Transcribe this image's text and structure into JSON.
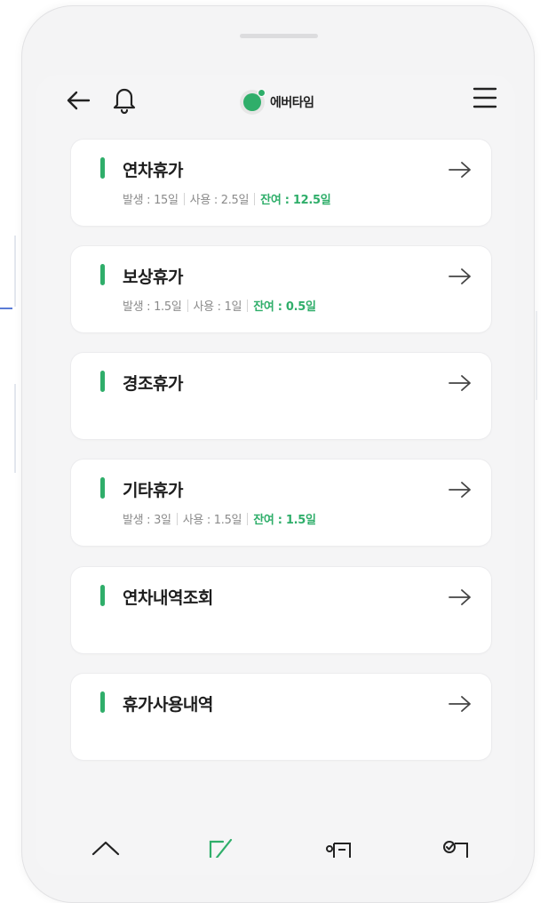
{
  "header": {
    "brand": "에버타임",
    "icons": [
      "arrow-left-icon",
      "bell-icon",
      "hamburger-menu-icon"
    ]
  },
  "cards": [
    {
      "title": "연차휴가",
      "issued": "발생 : 15일",
      "used": "사용 : 2.5일",
      "remaining": "잔여 : 12.5일"
    },
    {
      "title": "보상휴가",
      "issued": "발생 : 1.5일",
      "used": "사용 : 1일",
      "remaining": "잔여 : 0.5일"
    },
    {
      "title": "경조휴가"
    },
    {
      "title": "기타휴가",
      "issued": "발생 : 3일",
      "used": "사용 : 1.5일",
      "remaining": "잔여 : 1.5일"
    },
    {
      "title": "연차내역조회"
    },
    {
      "title": "휴가사용내역"
    }
  ],
  "bottom_nav": [
    "home-icon",
    "edit-icon",
    "card-icon",
    "check-icon"
  ],
  "colors": {
    "accent": "#2fae6a",
    "background": "#f5f5f6",
    "card": "#ffffff",
    "text": "#1d1d1d",
    "muted": "#8b8b8b"
  }
}
